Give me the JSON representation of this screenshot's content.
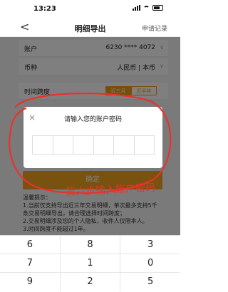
{
  "status_bar": {
    "time": "13:23"
  },
  "nav": {
    "back_icon": "<",
    "title": "明细导出",
    "apply_record": "申请记录"
  },
  "form": {
    "account": {
      "label": "账户",
      "value": "6230 **** 4072"
    },
    "currency": {
      "label": "币种",
      "value": "人民币 | 本币"
    },
    "time_span": {
      "label": "时间跨度",
      "options": [
        "近三月",
        "近半年"
      ],
      "selected": "近三月"
    }
  },
  "confirm_button": "确定",
  "tips": {
    "title": "温馨提示：",
    "lines": [
      "1.当前仅支持导出近三年交易明细，单次最多支持5千",
      "条交易明细导出，请合理选择时间跨度；",
      "2.交易明细涉及您的个人隐私，收件人仅限本人。",
      "3.时间跨度不能超过1年。"
    ]
  },
  "modal": {
    "title": "请输入您的账户密码",
    "close_icon": "×",
    "password_length": 6
  },
  "annotation": {
    "text": "第六步输入账户密码",
    "color": "#e8322d"
  },
  "keypad": {
    "rows": [
      [
        "6",
        "8",
        "3"
      ],
      [
        "7",
        "1",
        "0"
      ],
      [
        "9",
        "2",
        "5"
      ]
    ]
  },
  "colors": {
    "accent": "#f2a41f",
    "annotation": "#e8322d"
  }
}
